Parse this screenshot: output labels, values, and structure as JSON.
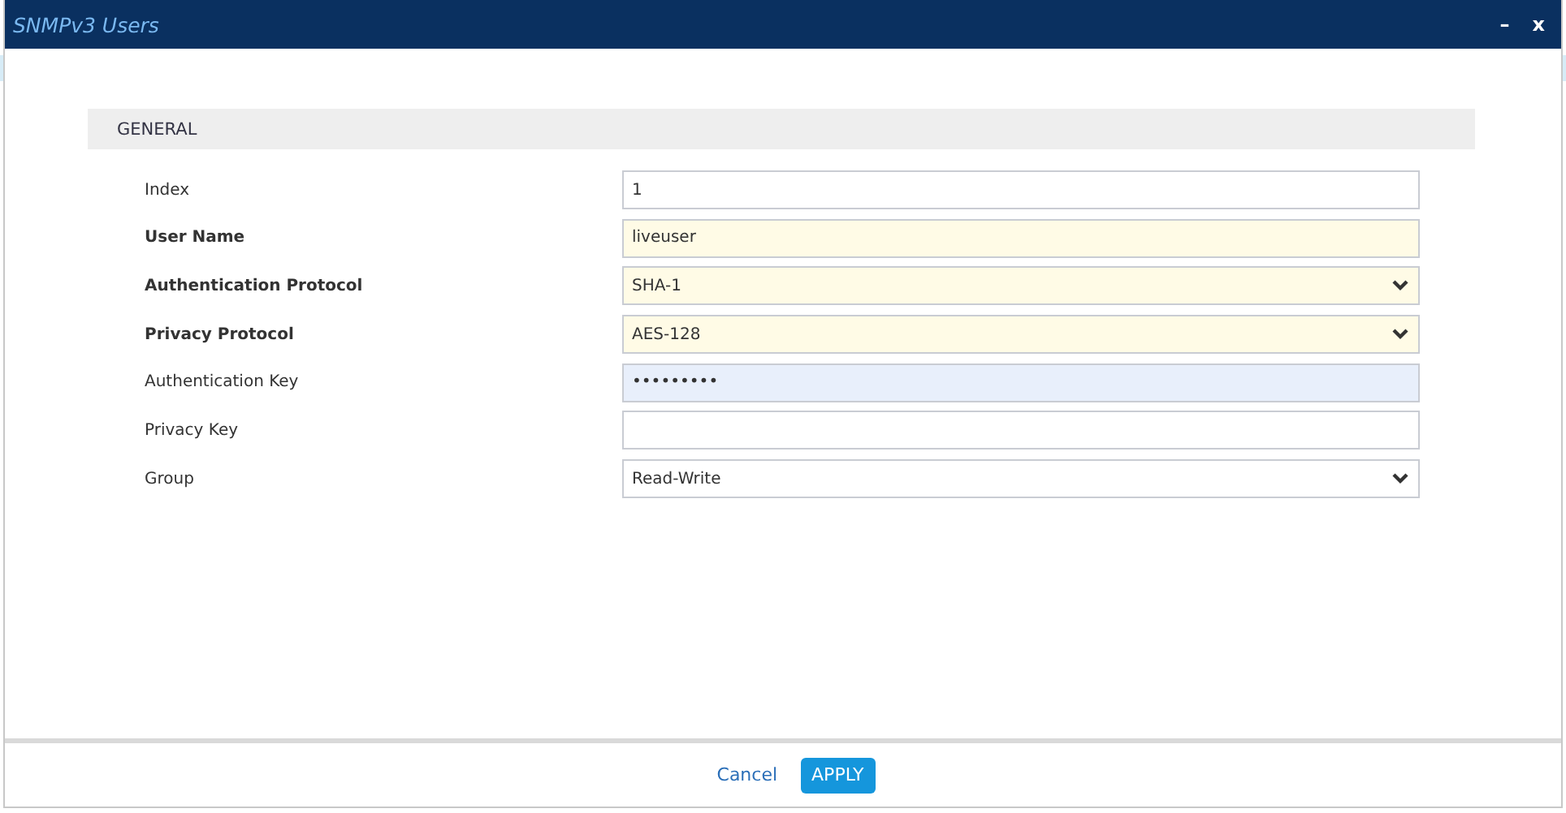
{
  "window": {
    "title": "SNMPv3 Users",
    "minimize": "–",
    "close": "x"
  },
  "section": {
    "title": "GENERAL"
  },
  "fields": [
    {
      "label": "Index",
      "kind": "text",
      "value": "1",
      "required": false,
      "modified": false,
      "focused": false
    },
    {
      "label": "User Name",
      "kind": "text",
      "value": "liveuser",
      "required": true,
      "modified": true,
      "focused": false
    },
    {
      "label": "Authentication Protocol",
      "kind": "select",
      "value": "SHA-1",
      "required": true,
      "modified": true,
      "focused": false
    },
    {
      "label": "Privacy Protocol",
      "kind": "select",
      "value": "AES-128",
      "required": true,
      "modified": true,
      "focused": false
    },
    {
      "label": "Authentication Key",
      "kind": "password",
      "value": "•••••••••",
      "required": false,
      "modified": false,
      "focused": true
    },
    {
      "label": "Privacy Key",
      "kind": "password",
      "required": false,
      "modified": false,
      "focused": false
    },
    {
      "label": "Group",
      "kind": "select",
      "value": "Read-Write",
      "required": false,
      "modified": false,
      "focused": false
    }
  ],
  "buttons": {
    "cancel": "Cancel",
    "apply": "APPLY"
  }
}
